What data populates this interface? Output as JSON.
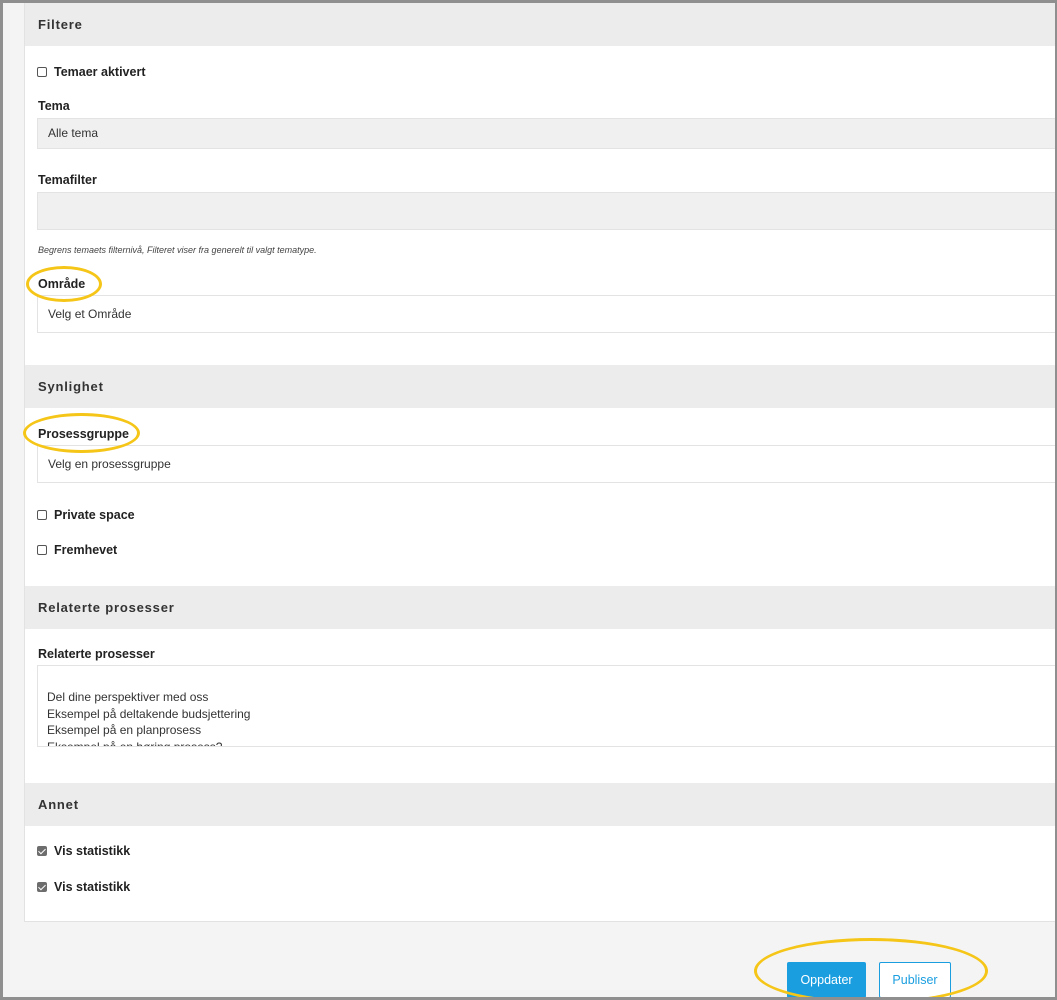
{
  "sections": {
    "filters": "Filtere",
    "visibility": "Synlighet",
    "related": "Relaterte prosesser",
    "other": "Annet"
  },
  "filters": {
    "themes_enabled": {
      "label": "Temaer aktivert",
      "checked": false
    },
    "theme_label": "Tema",
    "theme_value": "Alle tema",
    "theme_filter_label": "Temafilter",
    "theme_filter_value": "",
    "theme_filter_hint": "Begrens temaets filternivå, Filteret viser fra generelt til valgt tematype.",
    "area_label": "Område",
    "area_placeholder": "Velg et Område"
  },
  "visibility": {
    "process_group_label": "Prosessgruppe",
    "process_group_placeholder": "Velg en prosessgruppe",
    "private_space": {
      "label": "Private space",
      "checked": false
    },
    "highlighted": {
      "label": "Fremhevet",
      "checked": false
    }
  },
  "related": {
    "label": "Relaterte prosesser",
    "items": [
      "Del dine perspektiver med oss",
      "Eksempel på deltakende budsjettering",
      "Eksempel på en planprosess",
      "Eksempel på en høring prosess?"
    ]
  },
  "other": {
    "stats_1": {
      "label": "Vis statistikk",
      "checked": true
    },
    "stats_2": {
      "label": "Vis statistikk",
      "checked": true
    }
  },
  "actions": {
    "update": "Oppdater",
    "publish": "Publiser"
  },
  "colors": {
    "accent": "#1a9ee0",
    "highlight_ring": "#f5c518",
    "section_header": "#ececec"
  }
}
